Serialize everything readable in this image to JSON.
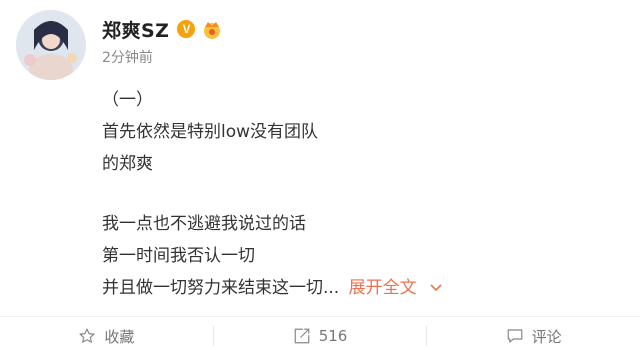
{
  "user": {
    "name": "郑爽SZ",
    "verified_badge": "V",
    "time": "2分钟前"
  },
  "post": {
    "lines": [
      "（一）",
      "首先依然是特别low没有团队",
      "的郑爽",
      "",
      "我一点也不逃避我说过的话",
      "第一时间我否认一切",
      "并且做一切努力来结束这一切..."
    ],
    "expand_label": "展开全文"
  },
  "actions": {
    "favorite_label": "收藏",
    "repost_count": "516",
    "comment_label": "评论"
  },
  "colors": {
    "accent_orange": "#eb7350",
    "badge_orange": "#f7a10c",
    "text": "#333333",
    "muted": "#8a8a8a"
  },
  "icons": [
    "star-icon",
    "repost-icon",
    "comment-icon",
    "chevron-down-icon",
    "verified-badge-icon",
    "member-crown-icon"
  ]
}
